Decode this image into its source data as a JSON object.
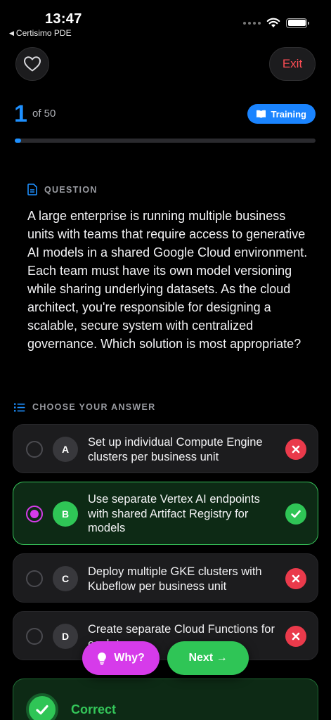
{
  "status_bar": {
    "time": "13:47",
    "back_app": "Certisimo PDE"
  },
  "header": {
    "favorite_icon": "heart-outline-icon",
    "exit_label": "Exit"
  },
  "progress": {
    "current": "1",
    "total_label": "of 50",
    "fraction": 0.02,
    "mode_badge": "Training"
  },
  "question": {
    "section_label": "QUESTION",
    "text": "A large enterprise is running multiple business units with teams that require access to generative AI models in a shared Google Cloud environment. Each team must have its own model versioning while sharing underlying datasets. As the cloud architect, you're responsible for designing a scalable, secure system with centralized governance. Which solution is most appropriate?"
  },
  "answers": {
    "section_label": "CHOOSE YOUR ANSWER",
    "options": [
      {
        "letter": "A",
        "text": "Set up individual Compute Engine clusters per business unit",
        "selected": false,
        "result": "wrong"
      },
      {
        "letter": "B",
        "text": "Use separate Vertex AI endpoints with shared Artifact Registry for models",
        "selected": true,
        "result": "correct"
      },
      {
        "letter": "C",
        "text": "Deploy multiple GKE clusters with Kubeflow per business unit",
        "selected": false,
        "result": "wrong"
      },
      {
        "letter": "D",
        "text": "Create separate Cloud Functions for each team",
        "selected": false,
        "result": "wrong"
      }
    ]
  },
  "actions": {
    "why_label": "Why?",
    "next_label": "Next →"
  },
  "result": {
    "label": "Correct"
  },
  "colors": {
    "accent_blue": "#1e90ff",
    "correct_green": "#2fc556",
    "wrong_red": "#ea3a4b",
    "why_magenta": "#d63bea"
  }
}
